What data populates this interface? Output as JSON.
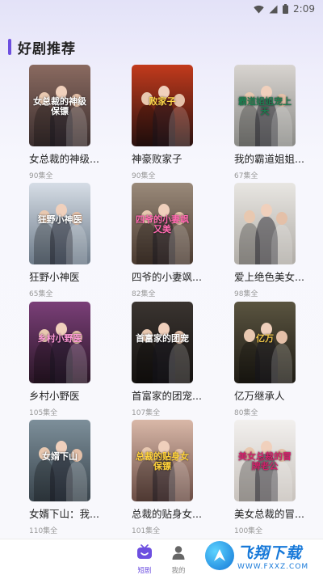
{
  "status_bar": {
    "time": "2:09"
  },
  "section": {
    "title": "好剧推荐"
  },
  "dramas": [
    {
      "title": "女总裁的神级...",
      "episodes": "90集全",
      "poster_caption": "女总裁的神级保镖",
      "bg1": "#8a6a60",
      "bg2": "#3a2e2e",
      "cap_color": "#ffffff"
    },
    {
      "title": "神豪败家子",
      "episodes": "90集全",
      "poster_caption": "败家子",
      "bg1": "#c23a1c",
      "bg2": "#2a1210",
      "cap_color": "#ffd84a"
    },
    {
      "title": "我的霸道姐姐...",
      "episodes": "67集全",
      "poster_caption": "霸道姐姐宠上天",
      "bg1": "#d8d4d0",
      "bg2": "#8a8a86",
      "cap_color": "#1f7a4f"
    },
    {
      "title": "狂野小神医",
      "episodes": "65集全",
      "poster_caption": "狂野小神医",
      "bg1": "#d6dde6",
      "bg2": "#6c7a88",
      "cap_color": "#ffffff"
    },
    {
      "title": "四爷的小妻飒...",
      "episodes": "82集全",
      "poster_caption": "四爷的小妻飒又美",
      "bg1": "#9a8a7a",
      "bg2": "#4a3a30",
      "cap_color": "#ff6ab0"
    },
    {
      "title": "爱上绝色美女...",
      "episodes": "98集全",
      "poster_caption": "",
      "bg1": "#e8e6e2",
      "bg2": "#b0aca6",
      "cap_color": "#333333"
    },
    {
      "title": "乡村小野医",
      "episodes": "105集全",
      "poster_caption": "乡村小野医",
      "bg1": "#7a3f78",
      "bg2": "#2a1626",
      "cap_color": "#ff9ad8"
    },
    {
      "title": "首富家的团宠...",
      "episodes": "107集全",
      "poster_caption": "首富家的团宠",
      "bg1": "#3a3430",
      "bg2": "#14110f",
      "cap_color": "#ffffff"
    },
    {
      "title": "亿万继承人",
      "episodes": "80集全",
      "poster_caption": "亿万",
      "bg1": "#5a5440",
      "bg2": "#1e1b14",
      "cap_color": "#f1c84a"
    },
    {
      "title": "女婿下山：我...",
      "episodes": "110集全",
      "poster_caption": "女婿下山",
      "bg1": "#7d8f9a",
      "bg2": "#39444c",
      "cap_color": "#ffffff"
    },
    {
      "title": "总裁的贴身女...",
      "episodes": "101集全",
      "poster_caption": "总裁的贴身女保镖",
      "bg1": "#d9b8a8",
      "bg2": "#6a4c44",
      "cap_color": "#ffd23a"
    },
    {
      "title": "美女总裁的冒...",
      "episodes": "100集全",
      "poster_caption": "美女总裁的冒牌老公",
      "bg1": "#f2f0ee",
      "bg2": "#c8c2bc",
      "cap_color": "#d0226a"
    }
  ],
  "tabbar": {
    "tabs": [
      {
        "label": "短剧",
        "icon": "tv-icon"
      },
      {
        "label": "我的",
        "icon": "user-icon"
      }
    ],
    "accent": "#6d4fe0"
  },
  "watermark": {
    "main": "飞翔下载",
    "sub": "WWW.FXXZ.COM"
  }
}
